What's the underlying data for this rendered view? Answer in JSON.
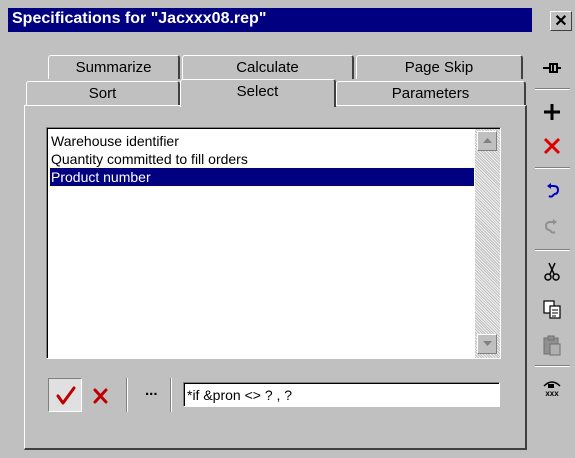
{
  "window": {
    "title": "Specifications for \"Jacxxx08.rep\"",
    "close_label": "✕"
  },
  "tabs": {
    "back_row": [
      "Summarize",
      "Calculate",
      "Page Skip"
    ],
    "front_row": [
      "Sort",
      "Select",
      "Parameters"
    ],
    "active": "Select"
  },
  "list": {
    "items": [
      "Warehouse identifier",
      "Quantity committed to fill orders",
      "Product number"
    ],
    "selected_index": 2
  },
  "expression": {
    "value": "*if &pron <> ? , ?",
    "ellipsis_label": "..."
  },
  "toolbar": {
    "icons": [
      "pin-icon",
      "add-icon",
      "delete-icon",
      "undo-icon",
      "redo-icon",
      "cut-icon",
      "copy-icon",
      "paste-icon",
      "report-icon"
    ]
  },
  "colors": {
    "titlebar": "#000080",
    "selection": "#000080",
    "accept": "#c00000",
    "delete": "#e00000",
    "undo": "#0000c0"
  }
}
